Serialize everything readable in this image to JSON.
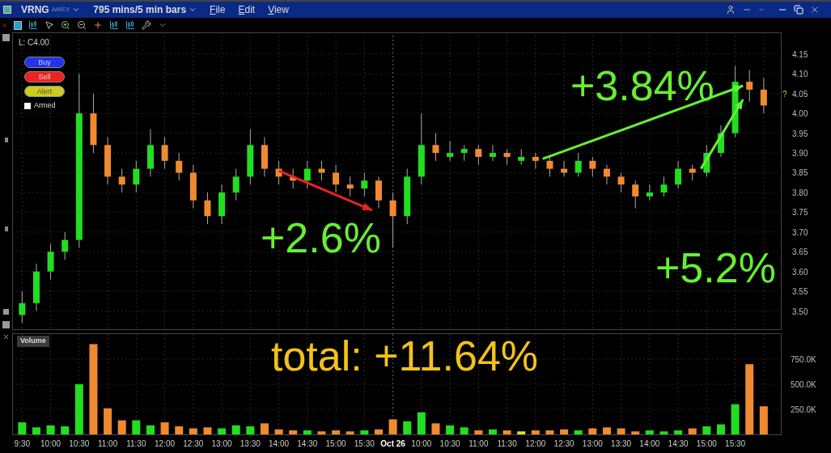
{
  "title_bar": {
    "symbol": "VRNG",
    "exchange": "AMEX",
    "period": "795 mins/5 min bars",
    "menus": [
      "File",
      "Edit",
      "View"
    ]
  },
  "order_panel": {
    "buttons": [
      {
        "label": "Buy",
        "kind": "buy"
      },
      {
        "label": "Sell",
        "kind": "sell"
      },
      {
        "label": "Alert",
        "kind": "alert"
      }
    ],
    "armed": {
      "label": "Armed",
      "checked": false
    }
  },
  "price_pane": {
    "legend": "L: C4.00",
    "last_marker": "?",
    "chart_data": {
      "type": "candlestick",
      "grid": true,
      "categories": [
        null,
        null,
        null,
        null,
        null,
        null,
        null,
        null,
        null,
        null,
        null,
        null,
        null,
        null,
        null,
        null,
        null,
        null,
        null,
        null,
        null,
        null,
        null,
        null,
        null,
        null,
        null,
        null,
        null,
        null,
        null,
        null,
        null,
        null,
        null,
        null,
        null,
        null,
        null,
        null,
        null,
        null,
        null,
        null,
        null,
        null,
        null,
        null,
        null,
        null,
        null,
        null,
        null
      ],
      "ohlc": [
        [
          3.49,
          3.55,
          3.47,
          3.52
        ],
        [
          3.52,
          3.62,
          3.5,
          3.6
        ],
        [
          3.6,
          3.67,
          3.58,
          3.65
        ],
        [
          3.65,
          3.7,
          3.63,
          3.68
        ],
        [
          3.68,
          4.1,
          3.66,
          4.0
        ],
        [
          4.0,
          4.05,
          3.9,
          3.92
        ],
        [
          3.92,
          3.94,
          3.82,
          3.84
        ],
        [
          3.84,
          3.86,
          3.8,
          3.82
        ],
        [
          3.82,
          3.88,
          3.8,
          3.86
        ],
        [
          3.86,
          3.96,
          3.84,
          3.92
        ],
        [
          3.92,
          3.94,
          3.86,
          3.88
        ],
        [
          3.88,
          3.9,
          3.83,
          3.85
        ],
        [
          3.85,
          3.87,
          3.76,
          3.78
        ],
        [
          3.78,
          3.8,
          3.72,
          3.74
        ],
        [
          3.74,
          3.82,
          3.72,
          3.8
        ],
        [
          3.8,
          3.86,
          3.78,
          3.84
        ],
        [
          3.84,
          3.96,
          3.82,
          3.92
        ],
        [
          3.92,
          3.94,
          3.84,
          3.86
        ],
        [
          3.86,
          3.88,
          3.82,
          3.84
        ],
        [
          3.84,
          3.86,
          3.81,
          3.83
        ],
        [
          3.83,
          3.88,
          3.81,
          3.86
        ],
        [
          3.86,
          3.88,
          3.83,
          3.85
        ],
        [
          3.85,
          3.87,
          3.8,
          3.82
        ],
        [
          3.82,
          3.84,
          3.79,
          3.81
        ],
        [
          3.81,
          3.85,
          3.79,
          3.83
        ],
        [
          3.83,
          3.84,
          3.76,
          3.78
        ],
        [
          3.78,
          3.8,
          3.66,
          3.74
        ],
        [
          3.74,
          3.86,
          3.72,
          3.84
        ],
        [
          3.84,
          4.0,
          3.82,
          3.92
        ],
        [
          3.92,
          3.95,
          3.88,
          3.9
        ],
        [
          3.89,
          3.93,
          3.88,
          3.9
        ],
        [
          3.9,
          3.92,
          3.88,
          3.91
        ],
        [
          3.91,
          3.92,
          3.87,
          3.89
        ],
        [
          3.89,
          3.92,
          3.88,
          3.9
        ],
        [
          3.9,
          3.91,
          3.87,
          3.89
        ],
        [
          3.88,
          3.91,
          3.87,
          3.89
        ],
        [
          3.89,
          3.9,
          3.86,
          3.88
        ],
        [
          3.88,
          3.89,
          3.84,
          3.86
        ],
        [
          3.86,
          3.88,
          3.84,
          3.85
        ],
        [
          3.85,
          3.9,
          3.84,
          3.88
        ],
        [
          3.88,
          3.89,
          3.84,
          3.86
        ],
        [
          3.86,
          3.87,
          3.82,
          3.84
        ],
        [
          3.84,
          3.85,
          3.8,
          3.82
        ],
        [
          3.82,
          3.83,
          3.76,
          3.79
        ],
        [
          3.79,
          3.82,
          3.78,
          3.8
        ],
        [
          3.8,
          3.84,
          3.79,
          3.82
        ],
        [
          3.82,
          3.88,
          3.81,
          3.86
        ],
        [
          3.86,
          3.87,
          3.83,
          3.85
        ],
        [
          3.85,
          3.92,
          3.84,
          3.9
        ],
        [
          3.9,
          3.97,
          3.89,
          3.95
        ],
        [
          3.95,
          4.12,
          3.94,
          4.08
        ],
        [
          4.08,
          4.11,
          4.03,
          4.06
        ],
        [
          4.06,
          4.09,
          4.0,
          4.02
        ]
      ],
      "ylim": [
        3.452,
        4.205
      ],
      "yticks": [
        {
          "value": 3.5,
          "label": "3.50"
        },
        {
          "value": 3.55,
          "label": "3.55"
        },
        {
          "value": 3.6,
          "label": "3.60"
        },
        {
          "value": 3.65,
          "label": "3.65"
        },
        {
          "value": 3.7,
          "label": "3.70"
        },
        {
          "value": 3.75,
          "label": "3.75"
        },
        {
          "value": 3.8,
          "label": "3.80"
        },
        {
          "value": 3.85,
          "label": "3.85"
        },
        {
          "value": 3.9,
          "label": "3.90"
        },
        {
          "value": 3.95,
          "label": "3.95"
        },
        {
          "value": 4.0,
          "label": "4.00"
        },
        {
          "value": 4.05,
          "label": "4.05"
        },
        {
          "value": 4.1,
          "label": "4.10"
        },
        {
          "value": 4.15,
          "label": "4.15"
        }
      ],
      "annotations": [
        {
          "text": "+3.84%"
        },
        {
          "text": "+2.6%"
        },
        {
          "text": "+5.2%"
        }
      ]
    }
  },
  "volume_pane": {
    "chart_data": {
      "type": "bar",
      "title": "Volume",
      "grid": true,
      "categories": [
        "9:30",
        null,
        "10:00",
        null,
        "10:30",
        null,
        "11:00",
        null,
        "11:30",
        null,
        "12:00",
        null,
        "12:30",
        null,
        "13:00",
        null,
        "13:30",
        null,
        "14:00",
        null,
        "14:30",
        null,
        "15:00",
        null,
        "15:30",
        null,
        "Oct 26",
        null,
        "10:00",
        null,
        "10:30",
        null,
        "11:00",
        null,
        "11:30",
        null,
        "12:00",
        null,
        "12:30",
        null,
        "13:00",
        null,
        "13:30",
        null,
        "14:00",
        null,
        "14:30",
        null,
        "15:00",
        null,
        "15:30",
        null,
        null
      ],
      "series": [
        {
          "color": "#22dd22",
          "values": [
            120,
            70,
            90,
            80,
            500,
            null,
            null,
            null,
            140,
            90,
            null,
            null,
            null,
            null,
            60,
            90,
            80,
            null,
            null,
            null,
            40,
            null,
            null,
            null,
            40,
            null,
            null,
            130,
            220,
            null,
            90,
            70,
            null,
            50,
            null,
            null,
            null,
            null,
            null,
            40,
            null,
            null,
            null,
            null,
            40,
            30,
            40,
            null,
            80,
            100,
            300,
            null,
            null
          ]
        },
        {
          "color": "#f08a30",
          "values": [
            null,
            null,
            null,
            null,
            null,
            900,
            260,
            140,
            null,
            null,
            120,
            80,
            60,
            70,
            null,
            null,
            null,
            110,
            50,
            40,
            null,
            30,
            40,
            30,
            null,
            50,
            150,
            null,
            null,
            110,
            null,
            null,
            40,
            null,
            40,
            null,
            40,
            40,
            50,
            null,
            60,
            70,
            60,
            30,
            null,
            null,
            null,
            60,
            null,
            null,
            null,
            700,
            280
          ]
        },
        {
          "color": "#e8e020",
          "values": [
            null,
            null,
            null,
            null,
            null,
            null,
            null,
            null,
            null,
            null,
            null,
            null,
            null,
            null,
            null,
            null,
            null,
            null,
            null,
            null,
            null,
            null,
            null,
            null,
            null,
            null,
            null,
            null,
            null,
            null,
            null,
            null,
            null,
            null,
            null,
            30,
            null,
            null,
            null,
            null,
            null,
            null,
            null,
            null,
            null,
            null,
            null,
            null,
            null,
            null,
            null,
            null,
            null
          ]
        }
      ],
      "ylim": [
        0,
        1008
      ],
      "yticks": [
        {
          "value": 250,
          "label": "250.0K"
        },
        {
          "value": 500,
          "label": "500.0K"
        },
        {
          "value": 750,
          "label": "750.0K"
        }
      ],
      "annotations": [
        {
          "text": "total: +11.64%"
        }
      ]
    }
  }
}
